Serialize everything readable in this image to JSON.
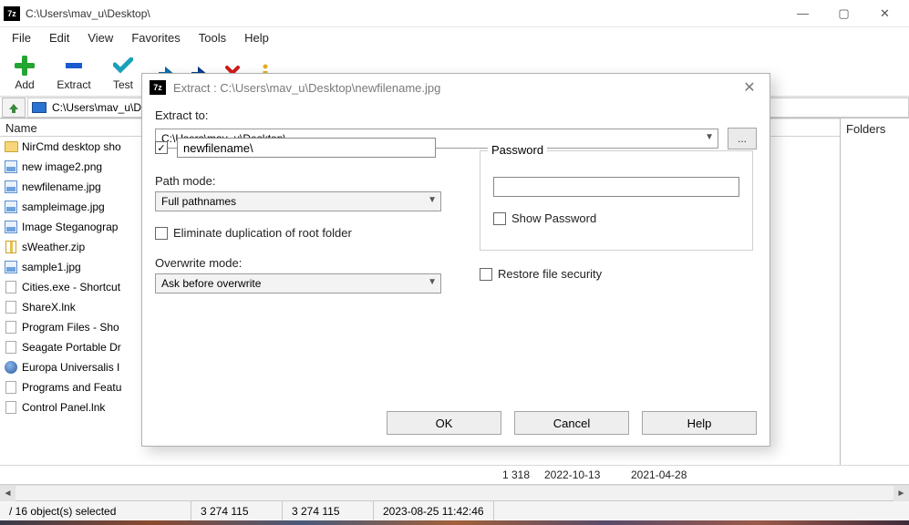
{
  "window": {
    "app_icon_text": "7z",
    "title": "C:\\Users\\mav_u\\Desktop\\",
    "min": "—",
    "max": "▢",
    "close": "✕"
  },
  "menu": [
    "File",
    "Edit",
    "View",
    "Favorites",
    "Tools",
    "Help"
  ],
  "toolbar": {
    "add": "Add",
    "extract": "Extract",
    "test": "Test"
  },
  "pathbar": {
    "up_icon": "⬆",
    "path": "C:\\Users\\mav_u\\Desktop\\"
  },
  "columns": {
    "name": "Name",
    "folders": "Folders"
  },
  "files": [
    {
      "icon": "folder",
      "name": "NirCmd desktop sho"
    },
    {
      "icon": "img",
      "name": "new image2.png"
    },
    {
      "icon": "img",
      "name": "newfilename.jpg"
    },
    {
      "icon": "img",
      "name": "sampleimage.jpg"
    },
    {
      "icon": "img",
      "name": "Image Steganograp"
    },
    {
      "icon": "zip",
      "name": "sWeather.zip"
    },
    {
      "icon": "img",
      "name": "sample1.jpg"
    },
    {
      "icon": "file",
      "name": "Cities.exe - Shortcut"
    },
    {
      "icon": "file",
      "name": "ShareX.lnk"
    },
    {
      "icon": "file",
      "name": "Program Files - Sho"
    },
    {
      "icon": "file",
      "name": "Seagate Portable Dr"
    },
    {
      "icon": "globe",
      "name": "Europa Universalis I"
    },
    {
      "icon": "file",
      "name": "Programs and Featu"
    },
    {
      "icon": "file",
      "name": "Control Panel.lnk"
    }
  ],
  "detail_row": {
    "size": "1 318",
    "date1": "2022-10-13",
    "date2": "2021-04-28"
  },
  "status": {
    "selection": "/ 16 object(s) selected",
    "num1": "3 274 115",
    "num2": "3 274 115",
    "timestamp": "2023-08-25 11:42:46"
  },
  "dialog": {
    "icon_text": "7z",
    "title": "Extract : C:\\Users\\mav_u\\Desktop\\newfilename.jpg",
    "close": "✕",
    "extract_to_label": "Extract to:",
    "extract_to_value": "C:\\Users\\mav_u\\Desktop\\",
    "browse_label": "...",
    "subfolder_value": "newfilename\\",
    "path_mode_label": "Path mode:",
    "path_mode_value": "Full pathnames",
    "eliminate_label": "Eliminate duplication of root folder",
    "overwrite_label": "Overwrite mode:",
    "overwrite_value": "Ask before overwrite",
    "password_label": "Password",
    "password_value": "",
    "show_password_label": "Show Password",
    "restore_label": "Restore file security",
    "ok": "OK",
    "cancel": "Cancel",
    "help": "Help"
  }
}
